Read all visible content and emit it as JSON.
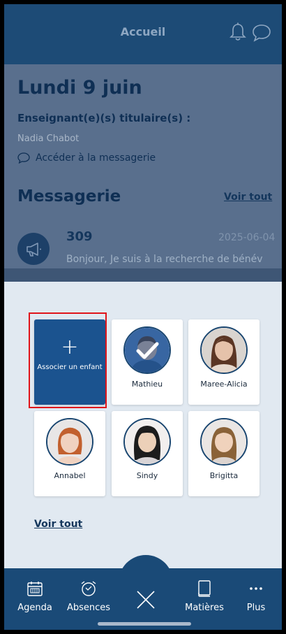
{
  "header": {
    "title": "Accueil"
  },
  "day": {
    "date": "Lundi 9 juin",
    "teacher_label": "Enseignant(e)(s) titulaire(s) :",
    "teacher_name": "Nadia Chabot",
    "messaging_link": "Accéder à la messagerie"
  },
  "messaging": {
    "title": "Messagerie",
    "see_all": "Voir tout",
    "latest": {
      "sender": "309",
      "date": "2025-06-04",
      "preview": "Bonjour, Je suis à la recherche de bénév"
    }
  },
  "children": {
    "add_label": "Associer un enfant",
    "items": [
      {
        "name": "Mathieu",
        "selected": true,
        "skin": "#e8c4a8",
        "hair": "#5a3a26",
        "bg": "#5a87c4"
      },
      {
        "name": "Maree-Alicia",
        "selected": false,
        "skin": "#e5c2aa",
        "hair": "#5b3624",
        "bg": "#d9d4cf"
      },
      {
        "name": "Annabel",
        "selected": false,
        "skin": "#f0d2c0",
        "hair": "#c2602e",
        "bg": "#e8e6e6"
      },
      {
        "name": "Sindy",
        "selected": false,
        "skin": "#ecd0b8",
        "hair": "#1c1c1c",
        "bg": "#f2efee"
      },
      {
        "name": "Brigitta",
        "selected": false,
        "skin": "#f0d2bc",
        "hair": "#8a6238",
        "bg": "#eae6e4"
      }
    ],
    "see_all": "Voir tout"
  },
  "nav": {
    "agenda": "Agenda",
    "absences": "Absences",
    "matieres": "Matières",
    "plus": "Plus"
  },
  "colors": {
    "primary": "#1a4a77",
    "add_card": "#1b538f",
    "highlight": "#e0141a"
  }
}
